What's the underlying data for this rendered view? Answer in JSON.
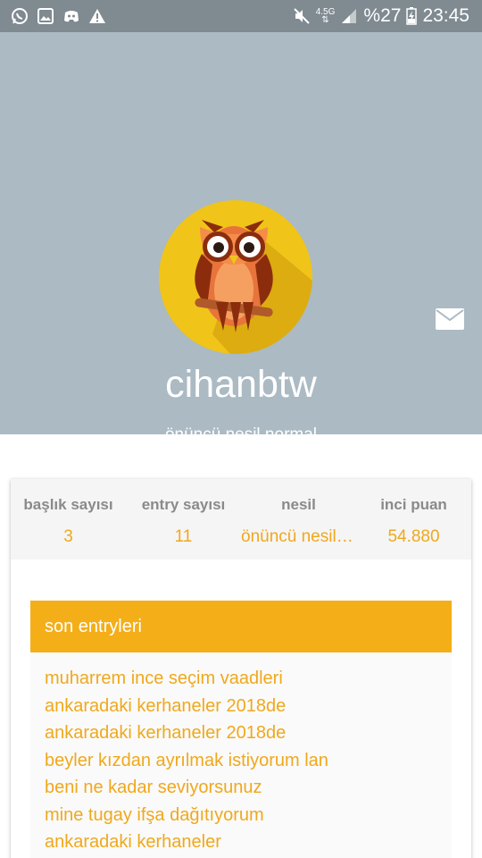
{
  "status_bar": {
    "network": "4.5G",
    "battery": "%27",
    "time": "23:45"
  },
  "profile": {
    "username": "cihanbtw",
    "subtitle": "önüncü nesil normal"
  },
  "stats": [
    {
      "label": "başlık sayısı",
      "value": "3"
    },
    {
      "label": "entry sayısı",
      "value": "11"
    },
    {
      "label": "nesil",
      "value": "önüncü nesil normal"
    },
    {
      "label": "inci puan",
      "value": "54.880"
    }
  ],
  "entries": {
    "title": "son entryleri",
    "items": [
      "muharrem ince seçim vaadleri",
      "ankaradaki kerhaneler 2018de",
      "ankaradaki kerhaneler 2018de",
      "beyler kızdan ayrılmak istiyorum lan",
      "beni ne kadar seviyorsunuz",
      "mine tugay ifşa dağıtıyorum",
      "ankaradaki kerhaneler"
    ]
  },
  "colors": {
    "header_bg": "#abbac3",
    "accent": "#f4ae18",
    "status_bar": "#7f8a91"
  }
}
